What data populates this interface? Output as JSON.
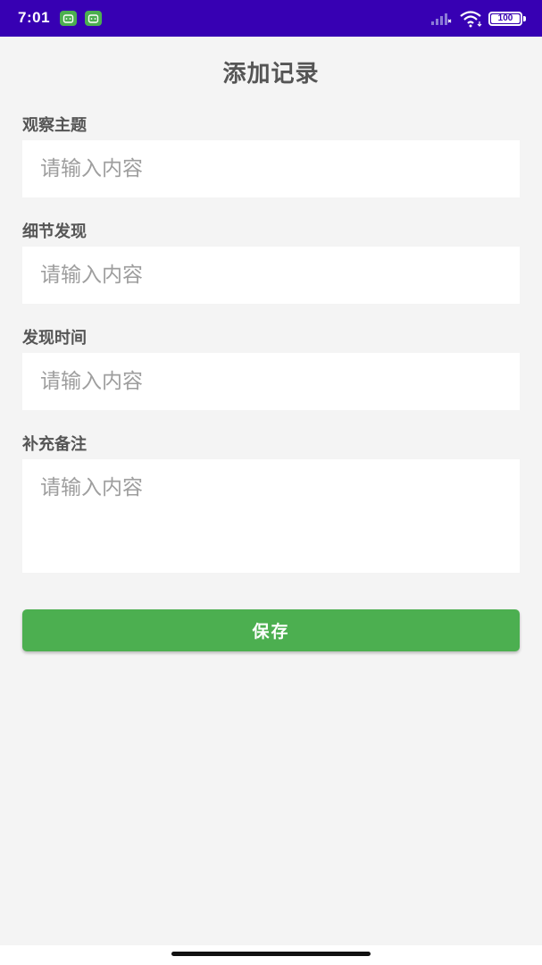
{
  "status_bar": {
    "time": "7:01",
    "battery": "100",
    "background_color": "#3700b3",
    "notification_icons": [
      "android-icon",
      "android-icon"
    ]
  },
  "page": {
    "title": "添加记录"
  },
  "form": {
    "fields": [
      {
        "label": "观察主题",
        "value": "",
        "placeholder": "请输入内容"
      },
      {
        "label": "细节发现",
        "value": "",
        "placeholder": "请输入内容"
      },
      {
        "label": "发现时间",
        "value": "",
        "placeholder": "请输入内容"
      },
      {
        "label": "补充备注",
        "value": "",
        "placeholder": "请输入内容"
      }
    ],
    "save_label": "保存",
    "accent_color": "#4caf50"
  }
}
